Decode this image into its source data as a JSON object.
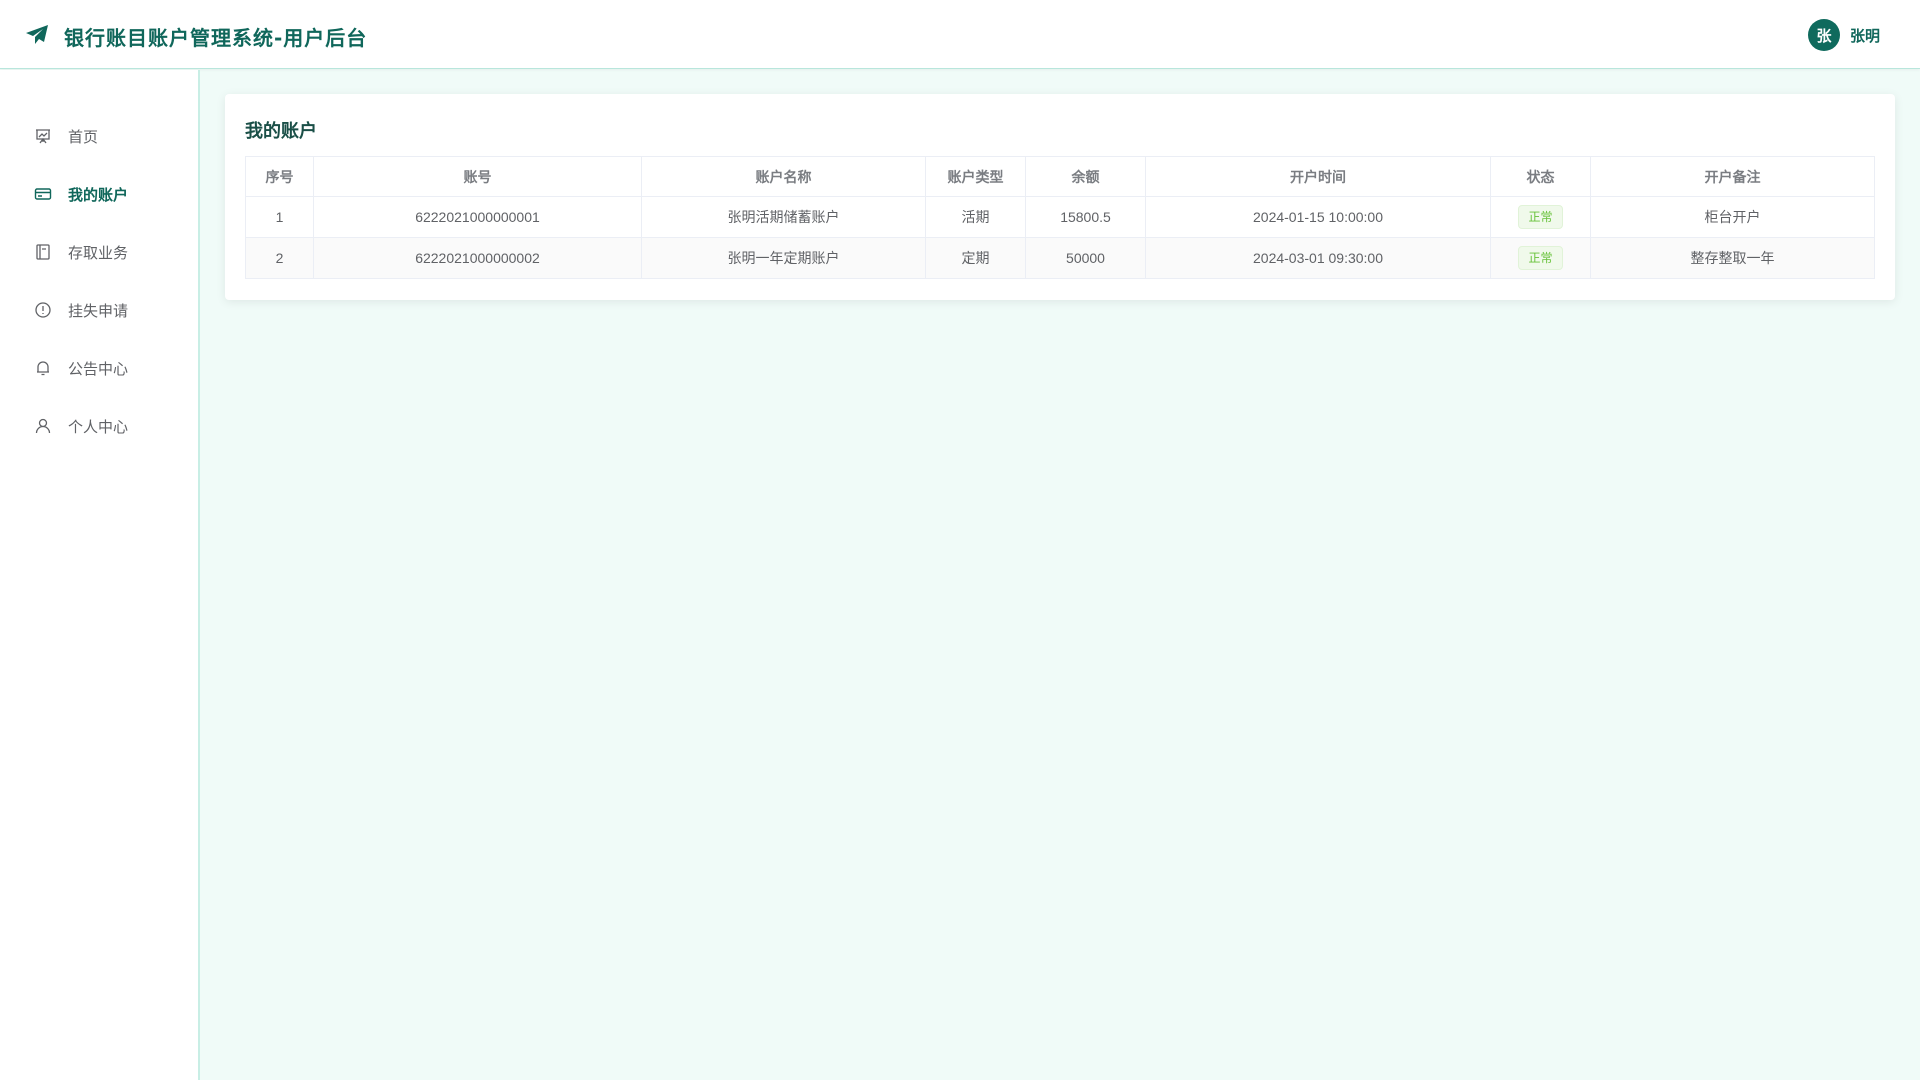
{
  "header": {
    "title": "银行账目账户管理系统-用户后台",
    "logo_icon": "paper-plane-icon",
    "user": {
      "avatar_text": "张",
      "name": "张明"
    }
  },
  "sidebar": {
    "items": [
      {
        "label": "首页",
        "icon": "presentation-icon",
        "active": false
      },
      {
        "label": "我的账户",
        "icon": "credit-card-icon",
        "active": true
      },
      {
        "label": "存取业务",
        "icon": "notebook-icon",
        "active": false
      },
      {
        "label": "挂失申请",
        "icon": "warning-circle-icon",
        "active": false
      },
      {
        "label": "公告中心",
        "icon": "bell-icon",
        "active": false
      },
      {
        "label": "个人中心",
        "icon": "user-icon",
        "active": false
      }
    ]
  },
  "main": {
    "title": "我的账户",
    "table": {
      "columns": [
        "序号",
        "账号",
        "账户名称",
        "账户类型",
        "余额",
        "开户时间",
        "状态",
        "开户备注"
      ],
      "rows": [
        [
          "1",
          "6222021000000001",
          "张明活期储蓄账户",
          "活期",
          "15800.5",
          "2024-01-15 10:00:00",
          "正常",
          "柜台开户"
        ],
        [
          "2",
          "6222021000000002",
          "张明一年定期账户",
          "定期",
          "50000",
          "2024-03-01 09:30:00",
          "正常",
          "整存整取一年"
        ]
      ]
    }
  },
  "colors": {
    "primary": "#10675b",
    "avatar_bg": "#0f6a5d",
    "page_bg": "#f0fbf8",
    "status_success": "#67c23a"
  }
}
